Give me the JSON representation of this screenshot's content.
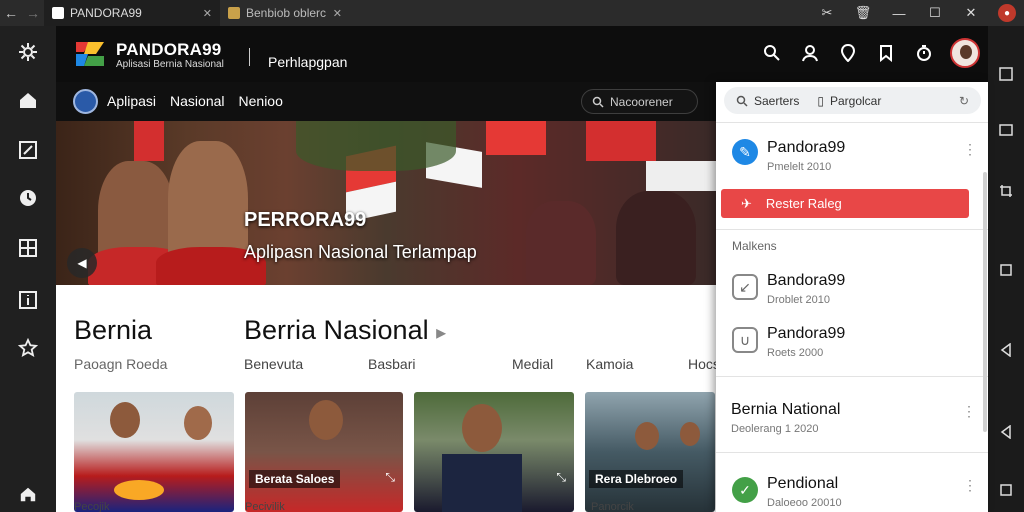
{
  "browser": {
    "tabs": [
      {
        "title": "PANDORA99",
        "active": true
      },
      {
        "title": "Benbiob oblerc",
        "active": false
      }
    ]
  },
  "header": {
    "brand": "PANDORA99",
    "brand_sub": "Aplisasi Bernia Nasional",
    "section": "Perhlapgpan"
  },
  "nav": {
    "links": [
      "Aplipasi",
      "Nasional",
      "Nenioo"
    ],
    "search_placeholder": "Nacoorener"
  },
  "hero": {
    "title": "PERRORA99",
    "subtitle": "Aplipasn Nasional Terlampap"
  },
  "content": {
    "title_left": "Bernia",
    "title_right": "Berria Nasional",
    "sub_left": "Paoagn Roeda",
    "categories": [
      "Benevuta",
      "Basbari",
      "Medial",
      "Kamoia",
      "Hocstooin"
    ],
    "cards": [
      {
        "label": "",
        "caption": "Pecojik"
      },
      {
        "label": "Berata Saloes",
        "caption": "Pecivilik"
      },
      {
        "label": "",
        "caption": ""
      },
      {
        "label": "Rera Dlebroeo",
        "caption": "Panorcik"
      }
    ]
  },
  "panel": {
    "search_left": "Saerters",
    "search_right": "Pargolcar",
    "item_top": {
      "title": "Pandora99",
      "sub": "Pmelelt 2010"
    },
    "action_button": "Rester Raleg",
    "section_label": "Malkens",
    "items": [
      {
        "title": "Bandora99",
        "sub": "Droblet 2010"
      },
      {
        "title": "Pandora99",
        "sub": "Roets 2000"
      }
    ],
    "item_news": {
      "title": "Bernia National",
      "sub": "Deolerang 1 2020"
    },
    "item_last": {
      "title": "Pendional",
      "sub": "Daloeoo 20010"
    }
  },
  "colors": {
    "accent_red": "#e84747",
    "header_bg": "#0d0d0d",
    "panel_bg": "#ffffff"
  }
}
